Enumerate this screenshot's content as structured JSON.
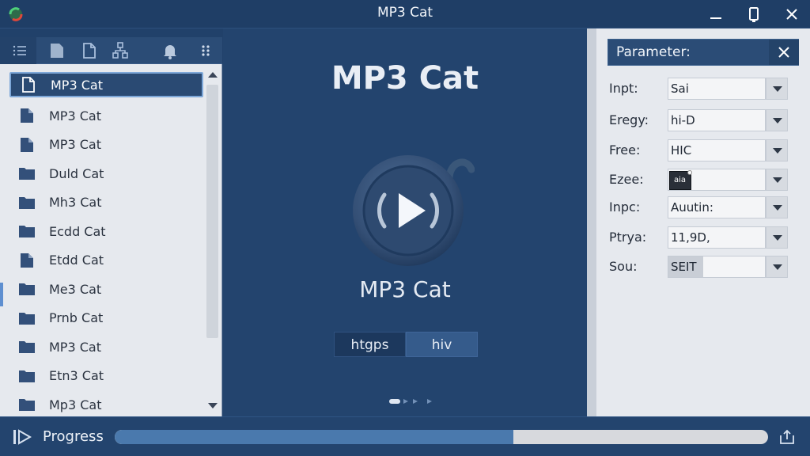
{
  "window": {
    "title": "MP3 Cat"
  },
  "toolbar": {
    "icons": [
      "list-icon",
      "document-icon",
      "document-outline-icon",
      "tree-icon",
      "bell-icon",
      "more-grid-icon"
    ]
  },
  "files": [
    {
      "label": "MP3 Cat",
      "icon": "document-outline-icon",
      "selected": true
    },
    {
      "label": "MP3 Cat",
      "icon": "document-icon"
    },
    {
      "label": "MP3 Cat",
      "icon": "document-icon"
    },
    {
      "label": "Duld Cat",
      "icon": "folder-icon"
    },
    {
      "label": "Mh3 Cat",
      "icon": "folder-icon"
    },
    {
      "label": "Ecdd Cat",
      "icon": "folder-icon"
    },
    {
      "label": "Etdd Cat",
      "icon": "document-icon"
    },
    {
      "label": "Me3 Cat",
      "icon": "folder-icon"
    },
    {
      "label": "Prnb Cat",
      "icon": "folder-icon"
    },
    {
      "label": "MP3 Cat",
      "icon": "folder-icon"
    },
    {
      "label": "Etn3 Cat",
      "icon": "folder-icon"
    },
    {
      "label": "Mp3 Cat",
      "icon": "folder-icon"
    }
  ],
  "center": {
    "title": "MP3 Cat",
    "subtitle": "MP3 Cat",
    "segment_a": "htgps",
    "segment_b": "hiv"
  },
  "parameters": {
    "title": "Parameter:",
    "rows": [
      {
        "label": "Inpt:",
        "value": "Sai"
      },
      {
        "label": "Eregy:",
        "value": "hi-D"
      },
      {
        "label": "Free:",
        "value": "HIC"
      },
      {
        "label": "Ezee:",
        "value": "aia"
      },
      {
        "label": "Inpc:",
        "value": "Auutin:"
      },
      {
        "label": "Ptrya:",
        "value": "11,9D,"
      },
      {
        "label": "Sou:",
        "value": "SEIT"
      }
    ]
  },
  "progress": {
    "label": "Progress",
    "value": 0.61
  },
  "colors": {
    "accent": "#2b4c76",
    "progress_fill": "#4a79ad",
    "background": "#21416a"
  }
}
